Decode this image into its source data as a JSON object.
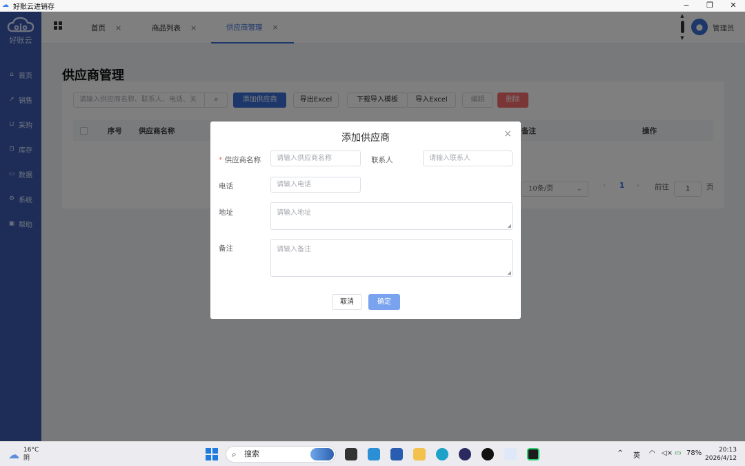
{
  "window": {
    "title": "好账云进销存",
    "minimize": "−",
    "maximize": "❐",
    "close": "✕"
  },
  "sidebar": {
    "logo_text": "好账云",
    "items": [
      {
        "icon": "home-icon",
        "glyph": "⌂",
        "label": "首页"
      },
      {
        "icon": "send-icon",
        "glyph": "➚",
        "label": "销售"
      },
      {
        "icon": "cart-icon",
        "glyph": "⊔",
        "label": "采购"
      },
      {
        "icon": "warehouse-icon",
        "glyph": "⊡",
        "label": "库存"
      },
      {
        "icon": "chart-icon",
        "glyph": "▭",
        "label": "数据"
      },
      {
        "icon": "gear-icon",
        "glyph": "⚙",
        "label": "系统"
      },
      {
        "icon": "help-icon",
        "glyph": "▣",
        "label": "帮助"
      }
    ]
  },
  "header": {
    "tabs": [
      {
        "label": "首页",
        "close": "×"
      },
      {
        "label": "商品列表",
        "close": "×"
      },
      {
        "label": "供应商管理",
        "close": "×",
        "active": true
      }
    ],
    "user": "管理员"
  },
  "page": {
    "title": "供应商管理",
    "search_placeholder": "请输入供应商名称、联系人、电话、关",
    "search_icon": "⌕",
    "buttons": {
      "add": "添加供应商",
      "export": "导出Excel",
      "download_template": "下载导入模板",
      "import": "导入Excel",
      "edit": "编辑",
      "delete": "删除"
    },
    "table_headers": [
      "序号",
      "供应商名称",
      "备注",
      "操作"
    ],
    "pager": {
      "page_size": "10条/页",
      "prev": "‹",
      "current": "1",
      "next": "›",
      "goto_label": "前往",
      "goto_value": "1",
      "page_unit": "页"
    }
  },
  "dialog": {
    "title": "添加供应商",
    "close": "×",
    "fields": {
      "name_label": "供应商名称",
      "name_required": "*",
      "name_placeholder": "请输入供应商名称",
      "contact_label": "联系人",
      "contact_placeholder": "请输入联系人",
      "phone_label": "电话",
      "phone_placeholder": "请输入电话",
      "address_label": "地址",
      "address_placeholder": "请输入地址",
      "remark_label": "备注",
      "remark_placeholder": "请输入备注"
    },
    "cancel": "取消",
    "confirm": "确定"
  },
  "taskbar": {
    "weather_temp": "16°C",
    "weather_desc": "阴",
    "search_label": "搜索",
    "tray_caret": "^",
    "ime": "英",
    "battery": "78%",
    "time": "20:13",
    "date": "2026/4/12"
  },
  "colors": {
    "primary": "#3b6fd6",
    "sidebar": "#3a5ab0",
    "danger": "#f56c6c"
  }
}
